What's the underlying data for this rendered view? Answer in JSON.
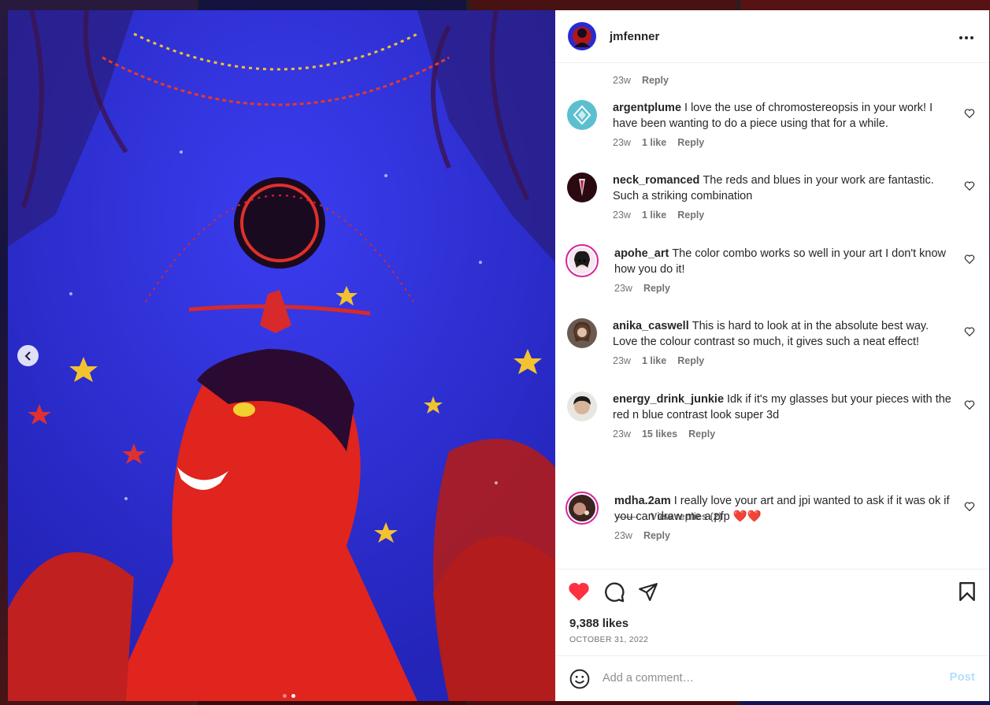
{
  "post": {
    "author": "jmfenner",
    "likes": "9,388 likes",
    "date": "OCTOBER 31, 2022",
    "carousel": {
      "total": 2,
      "active": 2
    }
  },
  "partial_comment": {
    "time": "23w",
    "reply": "Reply"
  },
  "comments": [
    {
      "user": "argentplume",
      "text": "I love the use of chromostereopsis in your work! I have been wanting to do a piece using that for a while.",
      "time": "23w",
      "likes": "1 like",
      "reply": "Reply"
    },
    {
      "user": "neck_romanced",
      "text": "The reds and blues in your work are fantastic. Such a striking combination",
      "time": "23w",
      "likes": "1 like",
      "reply": "Reply"
    },
    {
      "user": "apohe_art",
      "text": "The color combo works so well in your art I don't know how you do it!",
      "time": "23w",
      "likes": "",
      "reply": "Reply"
    },
    {
      "user": "anika_caswell",
      "text": "This is hard to look at in the absolute best way. Love the colour contrast so much, it gives such a neat effect!",
      "time": "23w",
      "likes": "1 like",
      "reply": "Reply"
    },
    {
      "user": "energy_drink_junkie",
      "text": "Idk if it's my glasses but your pieces with the red n blue contrast look super 3d",
      "time": "23w",
      "likes": "15 likes",
      "reply": "Reply"
    },
    {
      "user": "mdha.2am",
      "text": "I really love your art and jpi wanted to ask if it was ok if you can draw me a pfp ❤️❤️",
      "time": "23w",
      "likes": "",
      "reply": "Reply"
    }
  ],
  "view_replies": "View replies (2)",
  "add_comment": {
    "placeholder": "Add a comment…",
    "post_label": "Post"
  },
  "colors": {
    "like_red": "#ff3040",
    "link_blue": "#b2dffc",
    "text": "#262626",
    "muted": "#737373"
  },
  "icons": [
    "more-icon",
    "heart-icon",
    "comment-icon",
    "share-icon",
    "bookmark-icon",
    "emoji-icon",
    "chevron-left-icon"
  ]
}
